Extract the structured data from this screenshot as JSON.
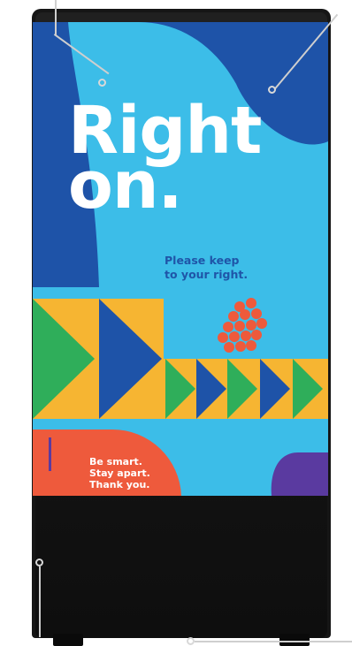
{
  "sign": {
    "headline_line1": "Right",
    "headline_line2": "on.",
    "subtext_line1": "Please keep",
    "subtext_line2": "to your right.",
    "footer_line1": "Be smart.",
    "footer_line2": "Stay apart.",
    "footer_line3": "Thank you."
  },
  "colors": {
    "sky": "#3cbde8",
    "navy": "#1e53a8",
    "yellow": "#f6b532",
    "green": "#2fae5a",
    "coral": "#ee5a3c",
    "purple": "#5a3aa0",
    "frame": "#161616"
  }
}
